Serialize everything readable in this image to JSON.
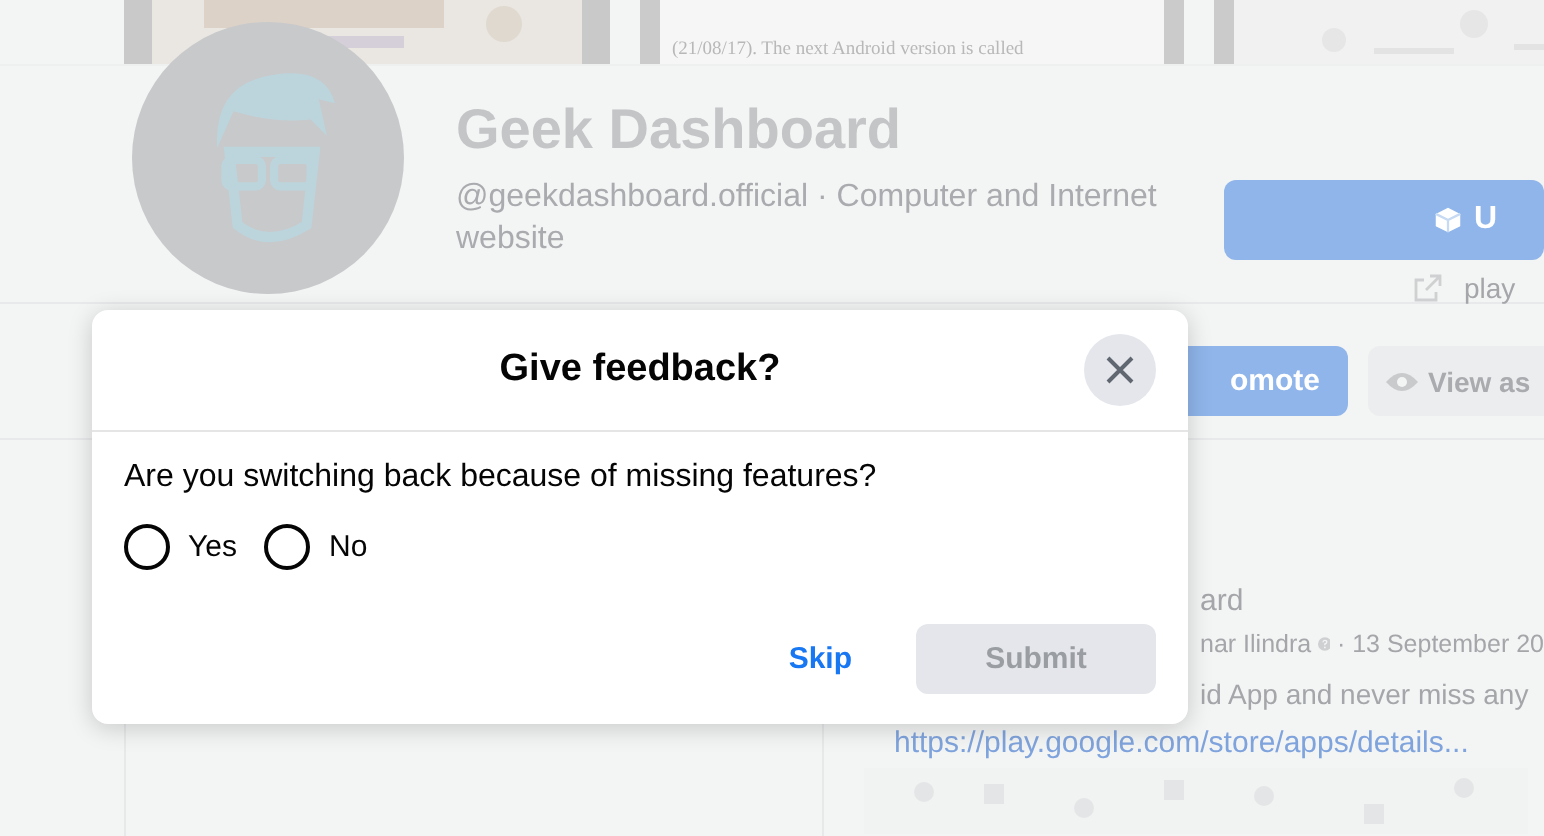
{
  "cover": {
    "snippet": "(21/08/17). The next Android version is called"
  },
  "page": {
    "name": "Geek Dashboard",
    "subtitle": "@geekdashboard.official · Computer and Internet website",
    "primary_button": "U",
    "link": "play"
  },
  "actions": [
    {
      "label": "omote",
      "kind": "primary"
    },
    {
      "label": "View as",
      "kind": "secondary"
    }
  ],
  "post": {
    "author": "ard",
    "byline": "nar Ilindra",
    "date": "· 13 September 20",
    "body": "id App and never miss any",
    "link": "https://play.google.com/store/apps/details..."
  },
  "dialog": {
    "title": "Give feedback?",
    "question": "Are you switching back because of missing features?",
    "options": [
      {
        "label": "Yes",
        "selected": false
      },
      {
        "label": "No",
        "selected": false
      }
    ],
    "skip": "Skip",
    "submit": {
      "label": "Submit",
      "disabled": true
    }
  }
}
